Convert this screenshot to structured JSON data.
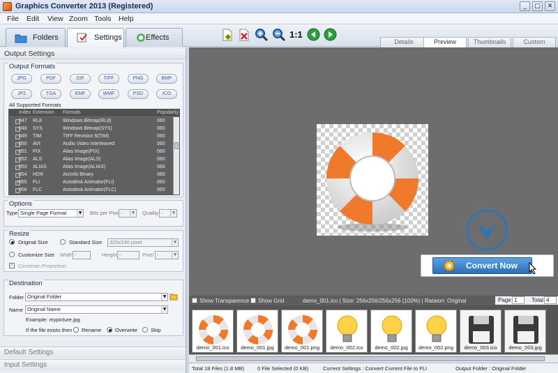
{
  "window": {
    "title": "Graphics Converter 2013  (Registered)",
    "min": "_",
    "max": "□",
    "close": "✕"
  },
  "menu": [
    "File",
    "Edit",
    "View",
    "Zoom",
    "Tools",
    "Help"
  ],
  "tabs": [
    "Folders",
    "Settings",
    "Effects"
  ],
  "toolbar": {
    "zoom_actual": "1:1"
  },
  "view_tabs": [
    "Details",
    "Preview",
    "Thumbnails",
    "Custom"
  ],
  "left": {
    "header": "Output Settings",
    "output_formats": {
      "title": "Output Formats",
      "buttons": [
        "JPG",
        "PDF",
        "GIF",
        "TIFF",
        "PNG",
        "BMP",
        "JP2",
        "TGA",
        "EMF",
        "WMF",
        "PSD",
        "ICO"
      ],
      "all_label": "All Supported Formats",
      "columns": [
        "Index",
        "Extension",
        "Formats",
        "Popularity"
      ],
      "rows": [
        {
          "index": "047",
          "ext": "RL8",
          "fmt": "Windows Bitmap(RL8)",
          "pop": "060",
          "checked": ""
        },
        {
          "index": "048",
          "ext": "SYS",
          "fmt": "Windows Bitmap(SYS)",
          "pop": "060",
          "checked": ""
        },
        {
          "index": "049",
          "ext": "TIM",
          "fmt": "TIFF Revision 6(TIM)",
          "pop": "060",
          "checked": ""
        },
        {
          "index": "050",
          "ext": "AVI",
          "fmt": "Audio Video Interleaved",
          "pop": "060",
          "checked": ""
        },
        {
          "index": "051",
          "ext": "PIX",
          "fmt": "Alias Image(PIX)",
          "pop": "060",
          "checked": ""
        },
        {
          "index": "052",
          "ext": "ALS",
          "fmt": "Alias Image(ALS)",
          "pop": "060",
          "checked": ""
        },
        {
          "index": "053",
          "ext": "ALIAS",
          "fmt": "Alias Image(ALIAS)",
          "pop": "060",
          "checked": ""
        },
        {
          "index": "054",
          "ext": "HDR",
          "fmt": "ArcInfo Binary",
          "pop": "060",
          "checked": ""
        },
        {
          "index": "055",
          "ext": "FLI",
          "fmt": "Autodesk Animator(FLI)",
          "pop": "060",
          "checked": "✓"
        },
        {
          "index": "056",
          "ext": "FLC",
          "fmt": "Autodesk Animator(FLC)",
          "pop": "060",
          "checked": ""
        }
      ]
    },
    "options": {
      "title": "Options",
      "type_label": "Type",
      "type_value": "Single Page Format",
      "bpp_label": "Bits per Pixel",
      "bpp_value": "-",
      "quality_label": "Quality",
      "quality_value": "-"
    },
    "resize": {
      "title": "Resize",
      "original": "Original Size",
      "standard": "Standard Size",
      "standard_value": "320x240 pixel",
      "customize": "Customize Size",
      "width_label": "Width",
      "width_value": "-",
      "height_label": "Height",
      "height_value": "-",
      "unit_label": "Pixel",
      "unit_value": "-",
      "constrain": "Constrain Proportion"
    },
    "destination": {
      "title": "Destination",
      "folder_label": "Folder",
      "folder_value": "Original Folder",
      "name_label": "Name",
      "name_value": "Original Name",
      "example": "Example:  mypicture.jpg",
      "exists_label": "If the file exists then",
      "rename": "Rename",
      "overwrite": "Overwrite",
      "skip": "Skip"
    },
    "default_settings": "Default Settings",
    "input_settings": "Input Settings"
  },
  "preview": {
    "show_transparence": "Show Transparence",
    "show_grid": "Show Grid",
    "info": "demo_001.ico  |  Size: 256x256/256x256 (100%)  |  Rataion: Original",
    "page_label": "Page",
    "page_value": "1",
    "total_label": "Total",
    "total_value": "4",
    "convert_label": "Convert Now"
  },
  "thumbnails": [
    {
      "name": "demo_001.ico",
      "kind": "ring"
    },
    {
      "name": "demo_001.jpg",
      "kind": "ring"
    },
    {
      "name": "demo_001.png",
      "kind": "ring"
    },
    {
      "name": "demo_002.ico",
      "kind": "bulb"
    },
    {
      "name": "demo_002.jpg",
      "kind": "bulb"
    },
    {
      "name": "demo_002.png",
      "kind": "bulb"
    },
    {
      "name": "demo_003.ico",
      "kind": "disk"
    },
    {
      "name": "demo_003.jpg",
      "kind": "disk"
    }
  ],
  "status": {
    "total": "Total 18 Files (1.8 MB)",
    "selected": "0 File Selected (0 KB)",
    "current": "Current Settings : Convert Current File to FLI",
    "output": "Output Folder : Original Folder"
  },
  "colors": {
    "accent_orange": "#ef7a2c",
    "convert_blue": "#2f73b8",
    "preview_bg": "#6d6d6d"
  }
}
